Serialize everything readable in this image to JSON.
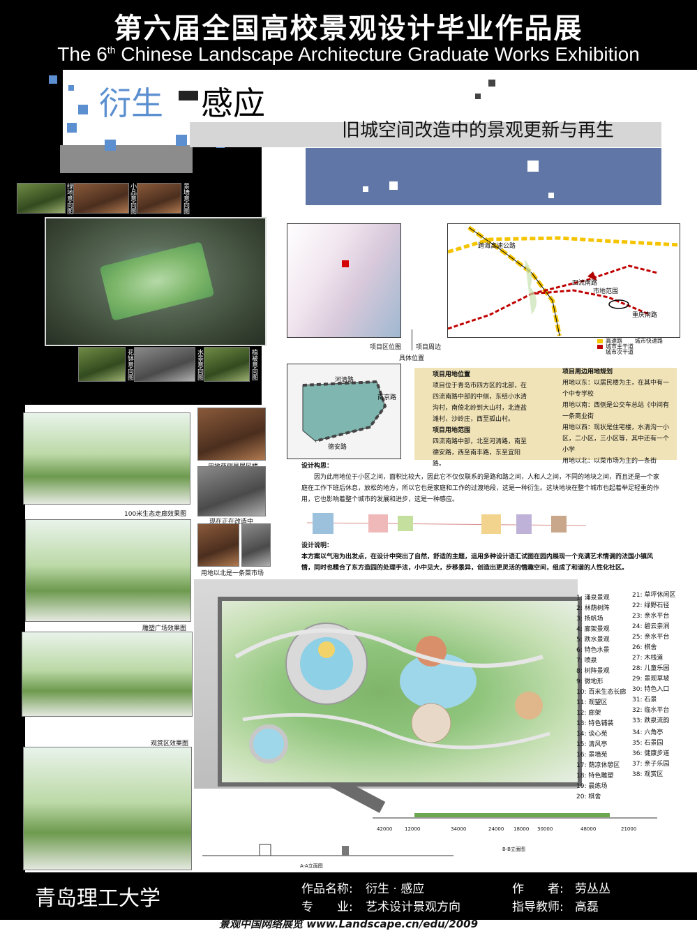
{
  "header": {
    "title_zh": "第六届全国高校景观设计毕业作品展",
    "title_en_pre": "The 6",
    "title_en_sup": "th",
    "title_en_post": " Chinese Landscape Architecture Graduate Works Exhibition"
  },
  "project": {
    "title_part1": "衍生",
    "title_part2": "感应",
    "subtitle": "旧城空间改造中的景观更新与再生"
  },
  "photo_labels": {
    "top_row": [
      "绿地意向图",
      "小品意向图",
      "景墙意向图"
    ],
    "mid_row": [
      "花钵意向图",
      "水景意向图",
      "植被意向图"
    ]
  },
  "maps": {
    "location_label": "项目区位图",
    "surroundings_label": "项目周边",
    "position_label": "具体位置",
    "legend": [
      "高速路",
      "城市快速路",
      "城市主干道",
      "城市次干道"
    ],
    "map2_labels": [
      "四流南路",
      "市地范围",
      "重庆南路",
      "跨海高速公路"
    ],
    "map3_labels": [
      "河清路",
      "南京路",
      "德安路"
    ]
  },
  "site_info": {
    "location_heading": "项目用地位置",
    "location_text": "项目位于青岛市四方区的北部，在四流南路中部的中侧，东结小水清沟村，南倚北岭到大山村，北连盐滩村，沙岭庄，西至孤山村。",
    "range_heading": "项目用地范围",
    "range_text": "四流南路中部，北至河清路，南至德安路，西至南丰路，东至宜阳路。",
    "plan_heading": "项目周边用地规划",
    "plan_lines": [
      "用地以东：以居民楼为主，在其中有一个中专学校",
      "用地以南：西侧是公交车总站《中间有一条商业街",
      "用地以西：现状是住宅楼，水清沟一小区，二小区，三小区等，其中还有一个小学",
      "用地以北：以菜市场为主的一条街"
    ]
  },
  "concept": {
    "heading": "设计构思：",
    "text": "因为此用地位于小区之间，面积比较大，因此它不仅仅联系的是路和路之间，人和人之间，不同的地块之间，而且还是一个家庭在工作下班后休息，放松的地方，所以它也是家庭和工作的过渡地段，这是一种衍生。这块地块在整个城市也起着举足轻重的作用，它也影响着整个城市的发展和进步，这是一种感应。"
  },
  "description": {
    "heading": "设计说明：",
    "text": "本方案以气泡为出发点，在设计中突出了自然，舒适的主题，运用多种设计语汇试图在园内展现一个充满艺术情调的法国小镇风情，同时也糅合了东方造园的处理手法，小中见大，步移景异，创造出更灵活的情趣空间，组成了和谐的人性化社区。"
  },
  "site_photos": {
    "labels": [
      "用地西侧是居民楼",
      "现在正在改造中",
      "用地以北是一条菜市场"
    ]
  },
  "renderings": {
    "labels": [
      "100米生态走廊效果图",
      "雕塑广场效果图",
      "观赏区效果图"
    ]
  },
  "plan_legend": {
    "left": [
      "1: 涌泉景观",
      "2: 林荫树阵",
      "3: 扬帆场",
      "4: 廊架景观",
      "5: 跌水景观",
      "6: 特色水景",
      "7: 喷泉",
      "8: 树阵景观",
      "9: 微地形",
      "10: 百米生态长廊",
      "11: 观望区",
      "12: 廊架",
      "13: 特色铺装",
      "14: 谈心苑",
      "15: 清风亭",
      "16: 景墙苑",
      "17: 荫凉休憩区",
      "18: 特色雕塑",
      "19: 晨练场",
      "20: 棋舍"
    ],
    "right": [
      "21: 草坪休闲区",
      "22: 绿野石径",
      "23: 亲水平台",
      "24: 碧云亲涧",
      "25: 亲水平台",
      "26: 棋舍",
      "27: 木栈道",
      "28: 儿童乐园",
      "29: 景观草坡",
      "30: 特色入口",
      "31: 石景",
      "32: 临水平台",
      "33: 跌泉流韵",
      "34: 六角亭",
      "35: 石景园",
      "36: 健康步道",
      "37: 亲子乐园",
      "38: 观赏区"
    ]
  },
  "sections": {
    "aa_label": "A-A立面图",
    "bb_label": "B-B立面图",
    "dims": [
      "42000",
      "12000",
      "34000",
      "24000",
      "18000",
      "30000",
      "48000",
      "21000"
    ]
  },
  "footer": {
    "school": "青岛理工大学",
    "work_label": "作品名称:",
    "work_value": "衍生 · 感应",
    "major_label": "专　　业:",
    "major_value": "艺术设计景观方向",
    "author_label": "作　　者:",
    "author_value": "劳丛丛",
    "advisor_label": "指导教师:",
    "advisor_value": "高磊",
    "bottom_line": "景观中国网络展览   www.Landscape.cn/edu/2009"
  },
  "colors": {
    "header_bg": "#000000",
    "accent_blue": "#5b8fd0",
    "band_blue": "#5f76a7",
    "info_box": "#f0e3b8"
  }
}
